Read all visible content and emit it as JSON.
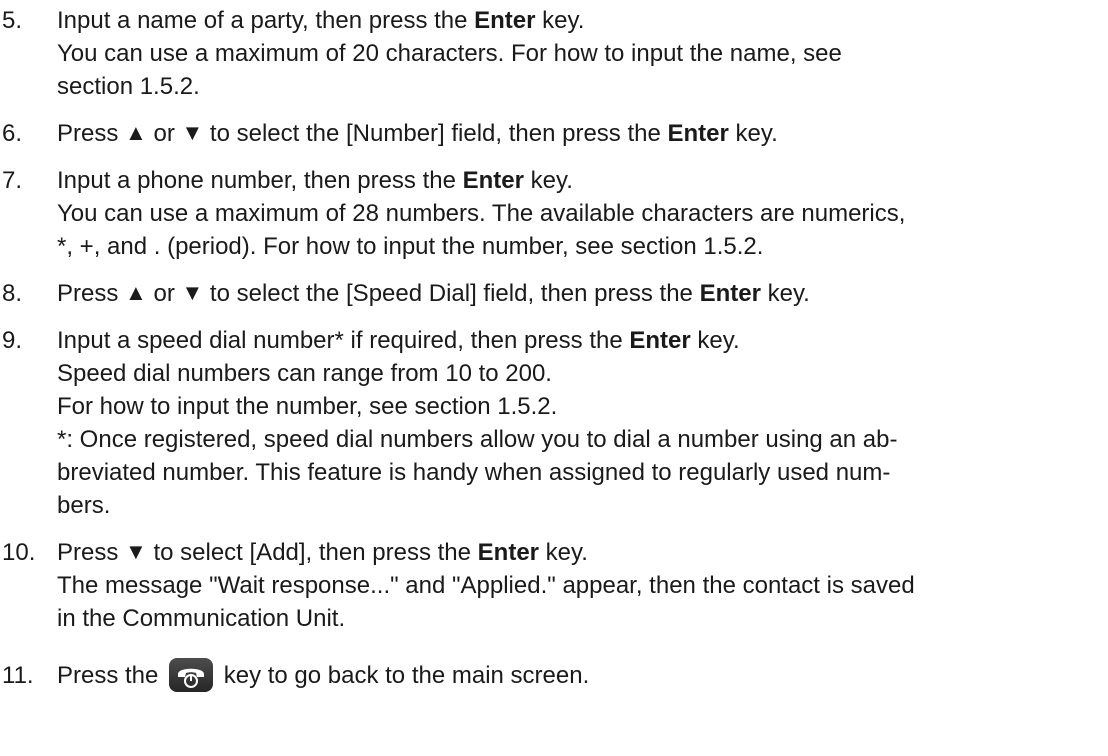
{
  "steps": [
    {
      "num": "5.",
      "l1_a": "Input a name of a party, then press the ",
      "l1_key": "Enter",
      "l1_b": " key.",
      "l2": "You can use a maximum of 20 characters. For how to input the name, see",
      "l3": "section 1.5.2."
    },
    {
      "num": "6.",
      "l1_a": "Press ",
      "up": "▲",
      "or": " or ",
      "down": "▼",
      "l1_b": " to select the [Number] field, then press the ",
      "l1_key": "Enter",
      "l1_c": " key."
    },
    {
      "num": "7.",
      "l1_a": "Input a phone number, then press the ",
      "l1_key": "Enter",
      "l1_b": " key.",
      "l2": "You can use a maximum of 28 numbers. The available characters are numerics,",
      "l3": "*, +, and . (period). For how to input the number, see section 1.5.2."
    },
    {
      "num": "8.",
      "l1_a": "Press ",
      "up": "▲",
      "or": " or ",
      "down": "▼",
      "l1_b": " to select the [Speed Dial] field, then press the ",
      "l1_key": "Enter",
      "l1_c": " key."
    },
    {
      "num": "9.",
      "l1_a": "Input a speed dial number* if required, then press the ",
      "l1_key": "Enter",
      "l1_b": " key.",
      "l2": "Speed dial numbers can range from 10 to 200.",
      "l3": "For how to input the number, see section 1.5.2.",
      "l4": "*: Once registered, speed dial numbers allow you to dial a number using an ab-",
      "l5": "breviated number. This feature is handy when assigned to regularly used num-",
      "l6": "bers."
    },
    {
      "num": "10.",
      "l1_a": "Press ",
      "down": "▼",
      "l1_b": " to select [Add], then press the ",
      "l1_key": "Enter",
      "l1_c": " key.",
      "l2": "The message \"Wait response...\" and \"Applied.\" appear, then the contact is saved",
      "l3": "in the Communication Unit."
    },
    {
      "num": "11.",
      "l1_a": "Press the ",
      "icon": "phone-hangup-key-icon",
      "l1_b": " key to go back to the main screen."
    }
  ]
}
